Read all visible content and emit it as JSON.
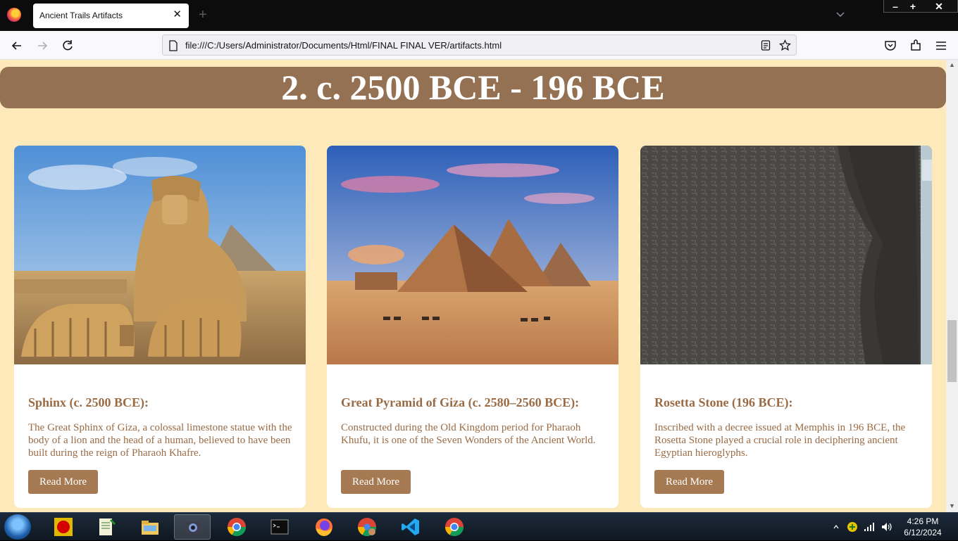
{
  "browser": {
    "tab_title": "Ancient Trails Artifacts",
    "tab_close": "✕",
    "new_tab": "+",
    "url": "file:///C:/Users/Administrator/Documents/Html/FINAL FINAL VER/artifacts.html",
    "window_controls": {
      "minimize": "–",
      "maximize": "+",
      "close": "✕"
    }
  },
  "page": {
    "era_heading": "2. c. 2500 BCE - 196 BCE",
    "cards": [
      {
        "title": "Sphinx (c. 2500 BCE):",
        "description": "The Great Sphinx of Giza, a colossal limestone statue with the body of a lion and the head of a human, believed to have been built during the reign of Pharaoh Khafre.",
        "button": "Read More",
        "image": "sphinx-photo"
      },
      {
        "title": "Great Pyramid of Giza (c. 2580–2560 BCE):",
        "description": "Constructed during the Old Kingdom period for Pharaoh Khufu, it is one of the Seven Wonders of the Ancient World.",
        "button": "Read More",
        "image": "pyramids-photo"
      },
      {
        "title": "Rosetta Stone (196 BCE):",
        "description": "Inscribed with a decree issued at Memphis in 196 BCE, the Rosetta Stone played a crucial role in deciphering ancient Egyptian hieroglyphs.",
        "button": "Read More",
        "image": "rosetta-stone-photo"
      }
    ]
  },
  "taskbar": {
    "clock_time": "4:26 PM",
    "clock_date": "6/12/2024"
  },
  "colors": {
    "page_bg": "#fde9b9",
    "banner": "#957153",
    "card_text": "#9a6b45",
    "button": "#a57a52"
  }
}
